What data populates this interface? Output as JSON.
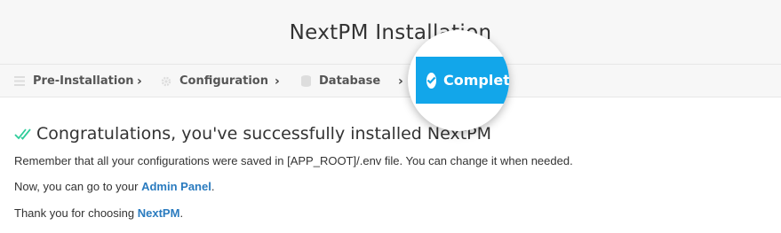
{
  "header": {
    "title": "NextPM Installation"
  },
  "steps": [
    {
      "label": "Pre-Installation",
      "icon": "list-icon"
    },
    {
      "label": "Configuration",
      "icon": "gear-icon"
    },
    {
      "label": "Database",
      "icon": "database-icon"
    },
    {
      "label": "Complete",
      "icon": "check-circle-icon",
      "active": true
    }
  ],
  "content": {
    "heading": "Congratulations, you've successfully installed NextPM",
    "line1": "Remember that all your configurations were saved in [APP_ROOT]/.env file. You can change it when needed.",
    "line2_prefix": "Now, you can go to your ",
    "line2_link": "Admin Panel",
    "line2_suffix": ".",
    "line3_prefix": "Thank you for choosing ",
    "line3_link": "NextPM",
    "line3_suffix": "."
  },
  "colors": {
    "accent": "#12a6ea",
    "link": "#2a7bbf",
    "check": "#2ecc9a"
  }
}
